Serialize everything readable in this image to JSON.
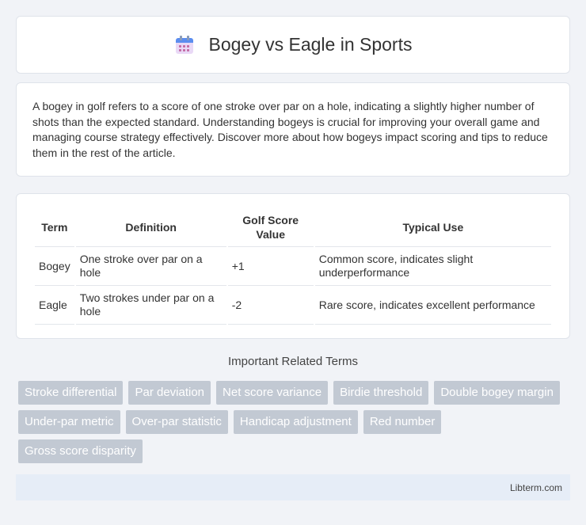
{
  "header": {
    "title": "Bogey vs Eagle in Sports",
    "icon": "calendar-icon"
  },
  "intro": {
    "text": "A bogey in golf refers to a score of one stroke over par on a hole, indicating a slightly higher number of shots than the expected standard. Understanding bogeys is crucial for improving your overall game and managing course strategy effectively. Discover more about how bogeys impact scoring and tips to reduce them in the rest of the article."
  },
  "table": {
    "headers": [
      "Term",
      "Definition",
      "Golf Score Value",
      "Typical Use"
    ],
    "rows": [
      [
        "Bogey",
        "One stroke over par on a hole",
        "+1",
        "Common score, indicates slight underperformance"
      ],
      [
        "Eagle",
        "Two strokes under par on a hole",
        "-2",
        "Rare score, indicates excellent performance"
      ]
    ]
  },
  "related": {
    "title": "Important Related Terms",
    "tags": [
      "Stroke differential",
      "Par deviation",
      "Net score variance",
      "Birdie threshold",
      "Double bogey margin",
      "Under-par metric",
      "Over-par statistic",
      "Handicap adjustment",
      "Red number",
      "Gross score disparity"
    ]
  },
  "footer": {
    "text": "Libterm.com"
  },
  "colors": {
    "tag_bg": "#c2c9d3",
    "page_bg": "#f1f3f7",
    "footer_bg": "#e6edf7"
  }
}
